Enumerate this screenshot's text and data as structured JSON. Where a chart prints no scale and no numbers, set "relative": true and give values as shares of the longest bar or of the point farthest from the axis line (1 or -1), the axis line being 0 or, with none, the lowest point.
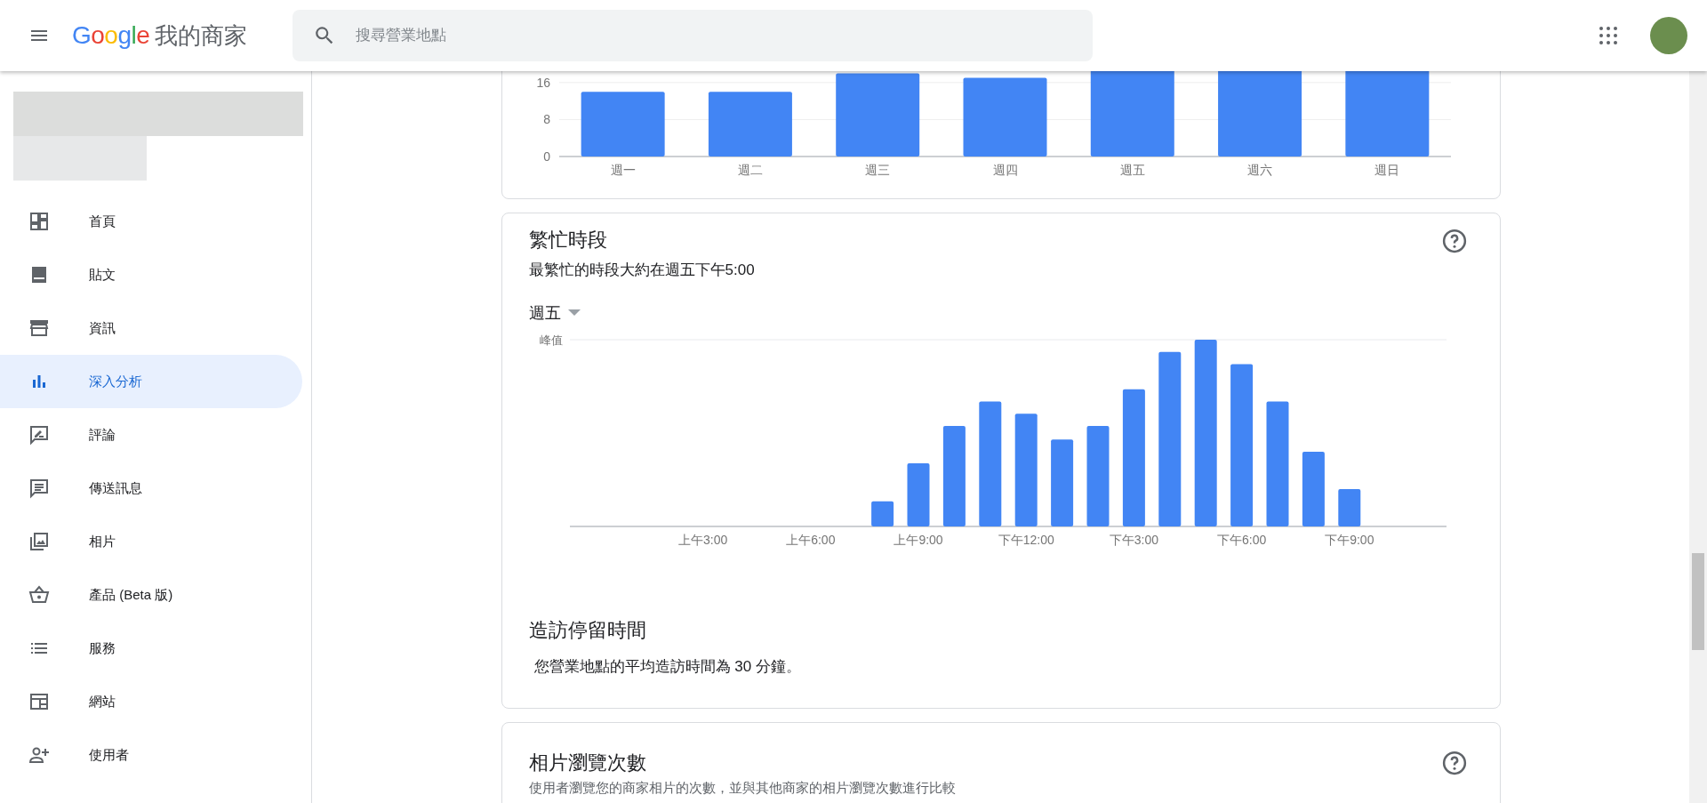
{
  "header": {
    "logo": "Google",
    "product": "我的商家",
    "search": {
      "placeholder": "搜尋營業地點"
    }
  },
  "sidebar": {
    "items": [
      {
        "label": "首頁",
        "selected": false
      },
      {
        "label": "貼文",
        "selected": false
      },
      {
        "label": "資訊",
        "selected": false
      },
      {
        "label": "深入分析",
        "selected": true
      },
      {
        "label": "評論",
        "selected": false
      },
      {
        "label": "傳送訊息",
        "selected": false
      },
      {
        "label": "相片",
        "selected": false
      },
      {
        "label": "產品 (Beta 版)",
        "selected": false
      },
      {
        "label": "服務",
        "selected": false
      },
      {
        "label": "網站",
        "selected": false
      },
      {
        "label": "使用者",
        "selected": false
      }
    ]
  },
  "weekly_card": {
    "axis_labels": [
      "16",
      "8",
      "0"
    ],
    "day_labels": [
      "週一",
      "週二",
      "週三",
      "週四",
      "週五",
      "週六",
      "週日"
    ]
  },
  "popular_times": {
    "title": "繁忙時段",
    "summary": "最繁忙的時段大約在週五下午5:00",
    "day": "週五",
    "peak_label": "峰值",
    "chart_data": {
      "type": "bar",
      "categories": [
        null,
        null,
        null,
        "上午3:00",
        null,
        null,
        "上午6:00",
        null,
        null,
        "上午9:00",
        null,
        null,
        "下午12:00",
        null,
        null,
        "下午3:00",
        null,
        null,
        "下午6:00",
        null,
        null,
        "下午9:00",
        null,
        null
      ],
      "series": [
        {
          "color": "#4285f4",
          "values": [
            0,
            0,
            0,
            0,
            0,
            0,
            0,
            0,
            0.134,
            0.338,
            0.538,
            0.669,
            0.603,
            0.466,
            0.538,
            0.734,
            0.934,
            1,
            0.869,
            0.669,
            0.4,
            0.2,
            0,
            0
          ]
        }
      ],
      "relative": true
    },
    "visit_title": "造訪停留時間",
    "visit_text": "您營業地點的平均造訪時間為 30 分鐘。"
  },
  "photo_views": {
    "title": "相片瀏覽次數",
    "text": "使用者瀏覽您的商家相片的次數，並與其他商家的相片瀏覽次數進行比較"
  }
}
